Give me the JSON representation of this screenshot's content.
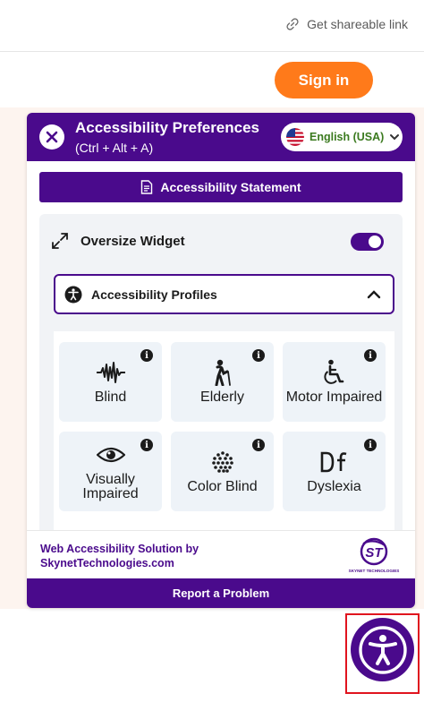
{
  "header": {
    "share_link": "Get shareable link"
  },
  "page": {
    "sign_in": "Sign in"
  },
  "widget": {
    "title": "Accessibility Preferences",
    "shortcut": "(Ctrl + Alt + A)",
    "language": "English (USA)",
    "statement_button": "Accessibility Statement",
    "oversize_label": "Oversize Widget",
    "oversize_enabled": true,
    "profiles_label": "Accessibility Profiles",
    "profiles": [
      {
        "label": "Blind",
        "icon": "waveform-icon"
      },
      {
        "label": "Elderly",
        "icon": "elderly-person-icon"
      },
      {
        "label": "Motor Impaired",
        "icon": "wheelchair-icon"
      },
      {
        "label": "Visually Impaired",
        "icon": "eye-icon"
      },
      {
        "label": "Color Blind",
        "icon": "color-dots-icon"
      },
      {
        "label": "Dyslexia",
        "icon": "df-letters-icon"
      }
    ],
    "brand_line1": "Web Accessibility Solution by",
    "brand_line2": "SkynetTechnologies.com",
    "brand_logo_text": "ST",
    "brand_logo_caption": "SKYNET TECHNOLOGIES",
    "report_button": "Report a Problem"
  },
  "colors": {
    "brand": "#4a0a8c",
    "signin": "#ff7a1a",
    "highlight": "#e0141e"
  }
}
